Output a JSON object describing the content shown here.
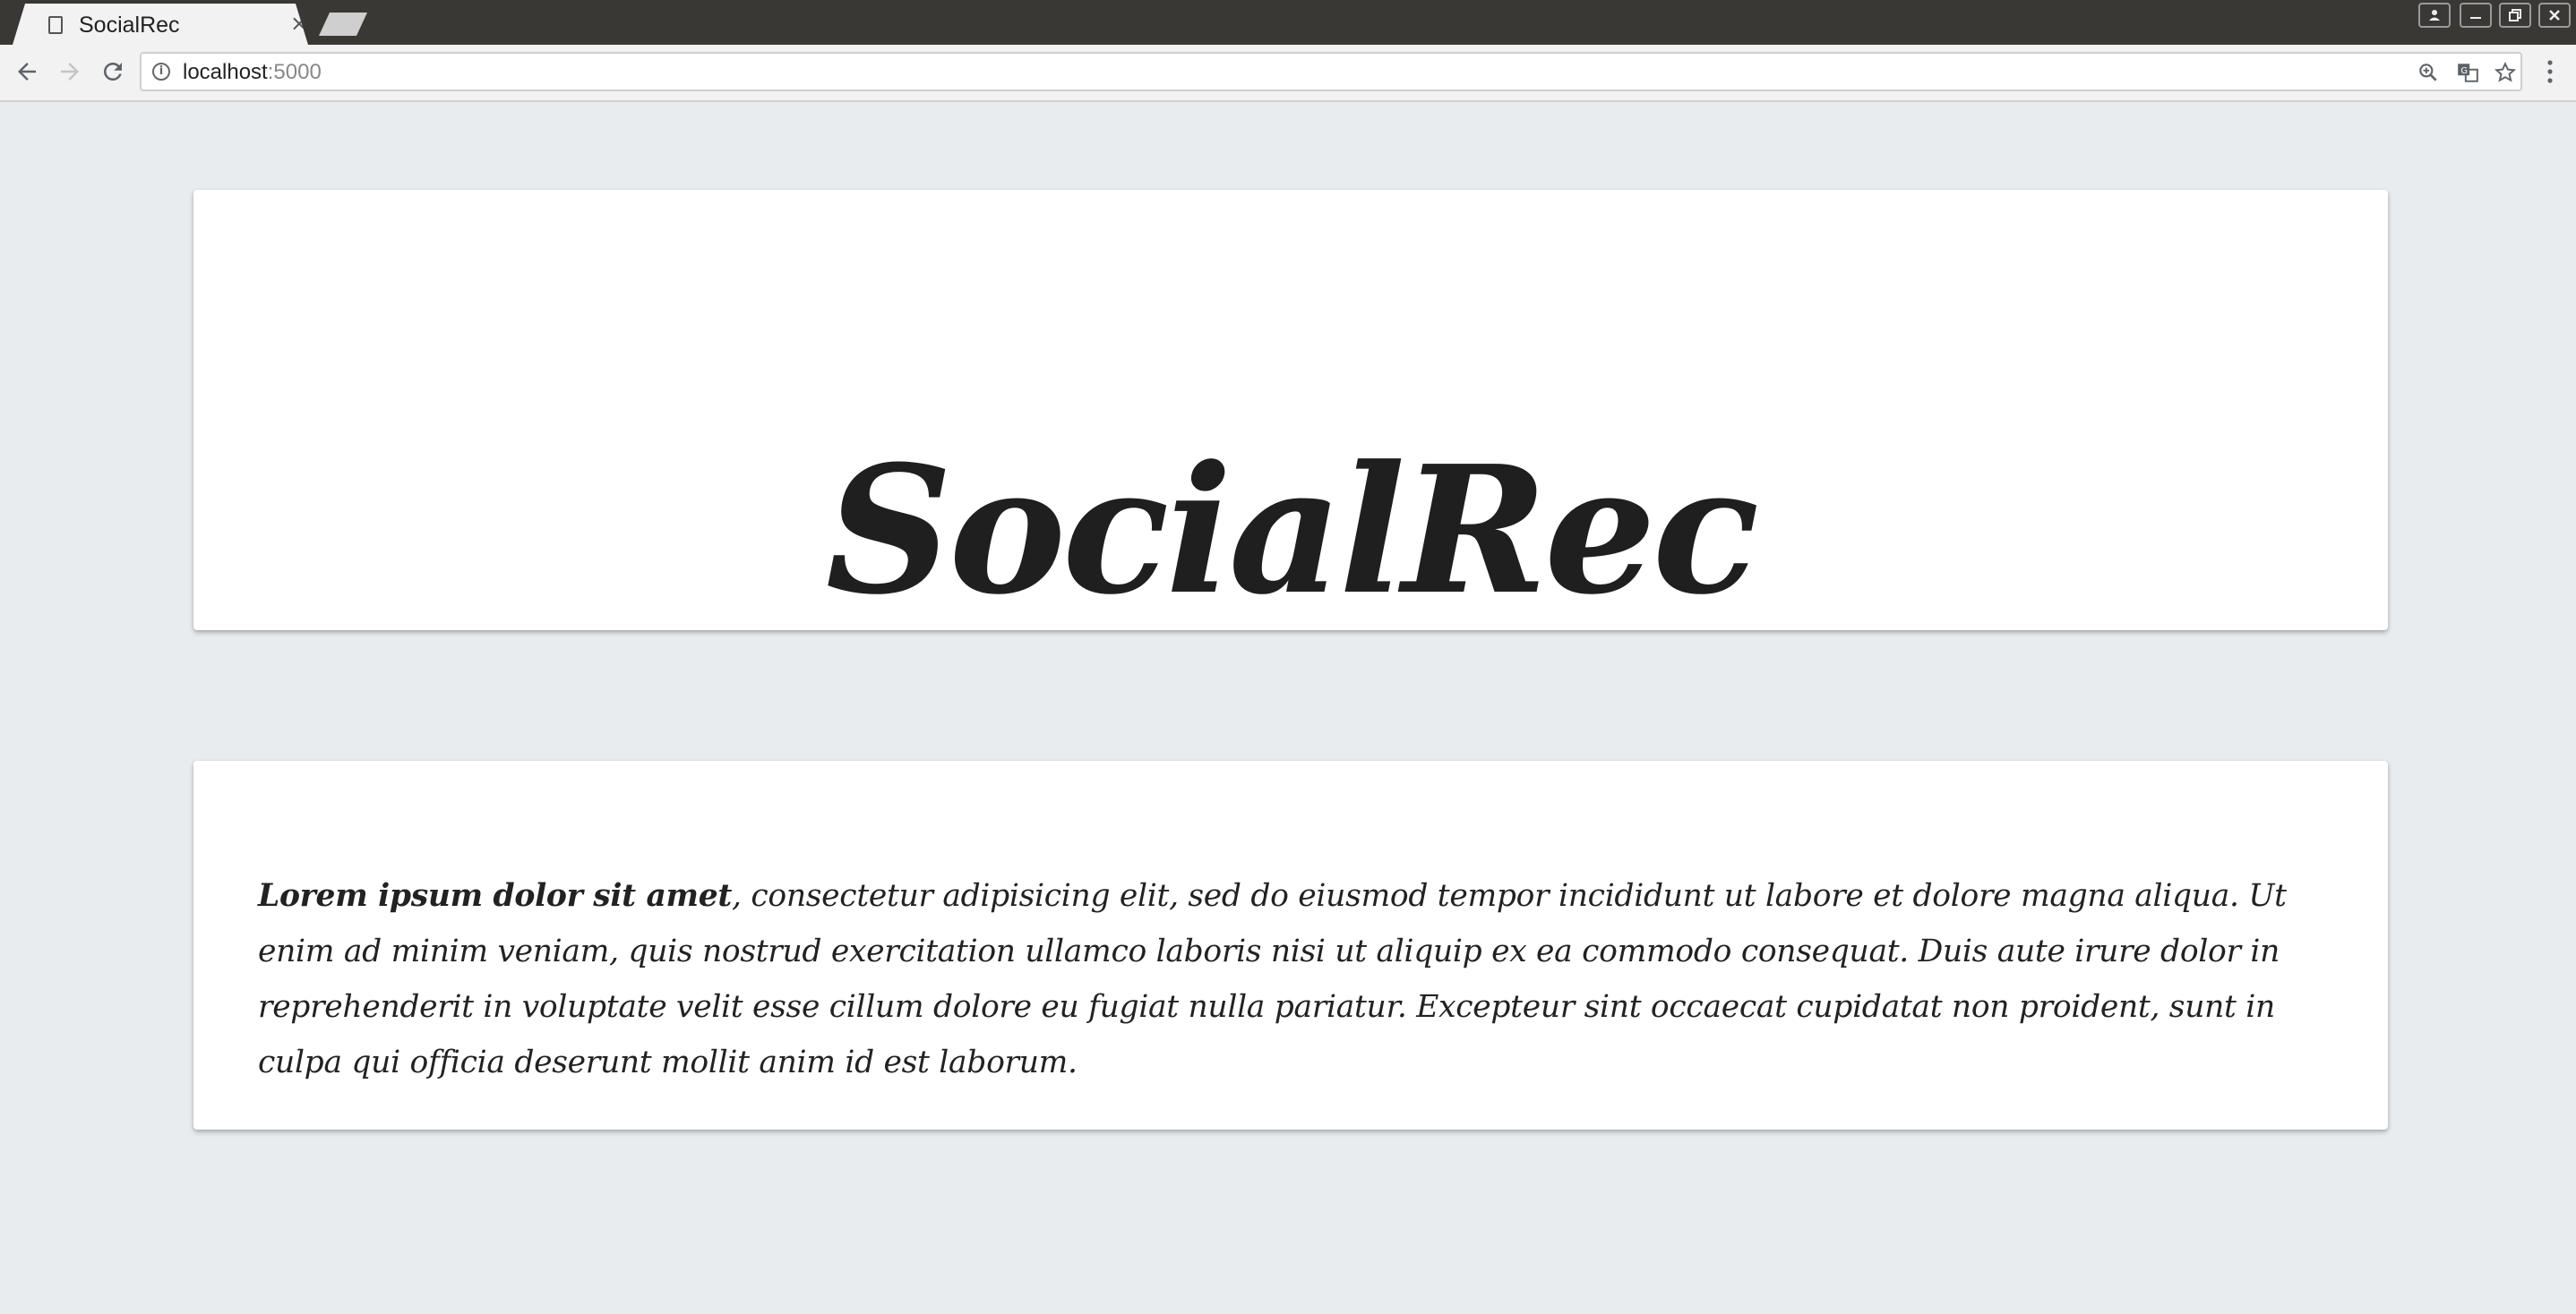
{
  "browser": {
    "tab": {
      "title": "SocialRec",
      "close_glyph": "×"
    },
    "address": {
      "host": "localhost",
      "port": ":5000"
    },
    "icons": {
      "back": "arrow-left-icon",
      "forward": "arrow-right-icon",
      "reload": "reload-icon",
      "info": "info-icon",
      "zoom": "zoom-icon",
      "translate": "translate-icon",
      "bookmark": "star-icon",
      "menu": "kebab-menu-icon",
      "profile": "profile-icon",
      "minimize": "minimize-icon",
      "restore": "restore-icon",
      "close": "close-icon"
    }
  },
  "page": {
    "hero": {
      "title": "SocialRec"
    },
    "intro": {
      "lead": "Lorem ipsum dolor sit amet",
      "body": ", consectetur adipisicing elit, sed do eiusmod tempor incididunt ut labore et dolore magna aliqua. Ut enim ad minim veniam, quis nostrud exercitation ullamco laboris nisi ut aliquip ex ea commodo consequat. Duis aute irure dolor in reprehenderit in voluptate velit esse cillum dolore eu fugiat nulla pariatur. Excepteur sint occaecat cupidatat non proident, sunt in culpa qui officia deserunt mollit anim id est laborum."
    }
  },
  "colors": {
    "page_background": "#e8ecef",
    "card_background": "#ffffff",
    "text": "#222222",
    "tabstrip": "#3a3835"
  }
}
